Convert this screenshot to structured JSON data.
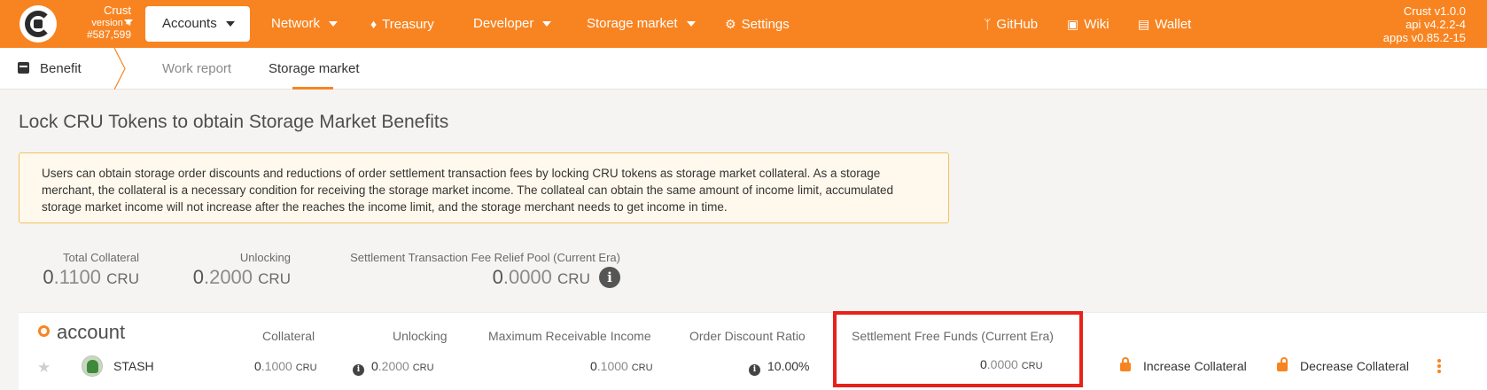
{
  "app": {
    "chain_name": "Crust",
    "chain_version": "version 4",
    "block_number": "#587,599",
    "versions": [
      "Crust v1.0.0",
      "api v4.2.2-4",
      "apps v0.85.2-15"
    ]
  },
  "nav": {
    "active": "Accounts",
    "items": [
      "Network",
      "Treasury",
      "Developer",
      "Storage market",
      "Settings"
    ],
    "right": [
      "GitHub",
      "Wiki",
      "Wallet"
    ]
  },
  "subnav": {
    "section": "Benefit",
    "tabs": [
      "Work report",
      "Storage market"
    ],
    "active_tab": "Storage market"
  },
  "page": {
    "title": "Lock CRU Tokens to obtain Storage Market Benefits",
    "notice": "Users can obtain storage order discounts and reductions of order settlement transaction fees by locking CRU tokens as storage market collateral. As a storage merchant, the collateral is a necessary condition for receiving the storage market income. The collateal can obtain the same amount of income limit, accumulated storage market income will not increase after the reaches the income limit, and the storage merchant needs to get income in time."
  },
  "summary": {
    "total_collateral": {
      "label": "Total Collateral",
      "int": "0",
      "frac": ".1100",
      "unit": "CRU"
    },
    "unlocking": {
      "label": "Unlocking",
      "int": "0",
      "frac": ".2000",
      "unit": "CRU"
    },
    "relief_pool": {
      "label": "Settlement Transaction Fee Relief Pool (Current Era)",
      "int": "0",
      "frac": ".0000",
      "unit": "CRU",
      "info": "i"
    }
  },
  "table": {
    "heading": "account",
    "columns": [
      "Collateral",
      "Unlocking",
      "Maximum Receivable Income",
      "Order Discount Ratio",
      "Settlement Free Funds (Current Era)"
    ],
    "row": {
      "name": "STASH",
      "collateral": {
        "int": "0",
        "frac": ".1000",
        "unit": "CRU"
      },
      "unlocking": {
        "int": "0",
        "frac": ".2000",
        "unit": "CRU",
        "info": "i"
      },
      "max_income": {
        "int": "0",
        "frac": ".1000",
        "unit": "CRU"
      },
      "discount_ratio": {
        "value": "10.00%",
        "info": "i"
      },
      "settlement_free": {
        "int": "0",
        "frac": ".0000",
        "unit": "CRU"
      },
      "actions": [
        "Increase Collateral",
        "Decrease Collateral"
      ]
    }
  },
  "colors": {
    "brand": "#f88421",
    "highlight": "#e8211a"
  }
}
